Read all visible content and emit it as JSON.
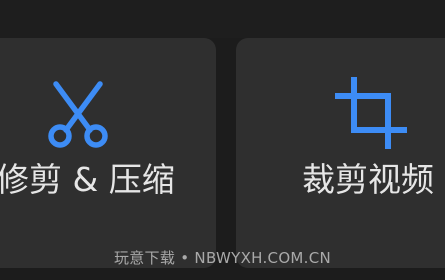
{
  "tiles": [
    {
      "label": "修剪 & 压缩",
      "icon": "scissors-icon",
      "icon_color": "#3d8cf5"
    },
    {
      "label": "裁剪视频",
      "icon": "crop-icon",
      "icon_color": "#3d8cf5"
    }
  ],
  "watermark": "玩意下载 • NBWYXH.COM.CN",
  "colors": {
    "background": "#1c1c1c",
    "tile": "#2f2f2f",
    "accent": "#3d8cf5",
    "text": "#e6e6e6"
  }
}
